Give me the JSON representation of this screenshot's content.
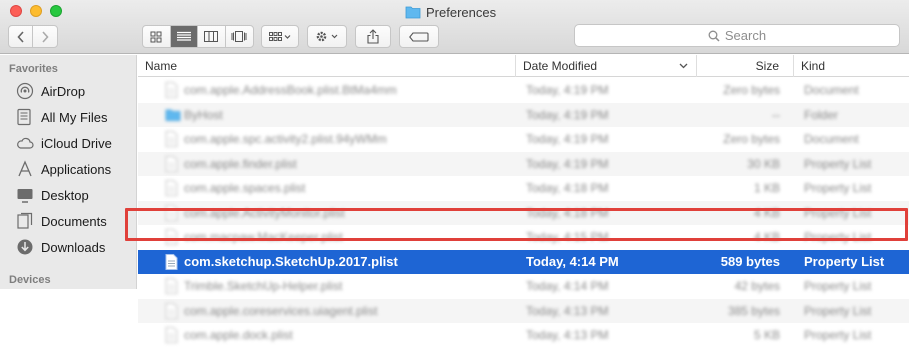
{
  "window": {
    "title": "Preferences"
  },
  "toolbar": {
    "search_placeholder": "Search"
  },
  "sidebar": {
    "favorites_heading": "Favorites",
    "devices_heading": "Devices",
    "items": [
      {
        "label": "AirDrop",
        "icon": "airdrop-icon"
      },
      {
        "label": "All My Files",
        "icon": "all-files-icon"
      },
      {
        "label": "iCloud Drive",
        "icon": "cloud-icon"
      },
      {
        "label": "Applications",
        "icon": "applications-icon"
      },
      {
        "label": "Desktop",
        "icon": "desktop-icon"
      },
      {
        "label": "Documents",
        "icon": "documents-icon"
      },
      {
        "label": "Downloads",
        "icon": "downloads-icon"
      }
    ]
  },
  "columns": {
    "name": "Name",
    "date": "Date Modified",
    "size": "Size",
    "kind": "Kind"
  },
  "rows": [
    {
      "name": "com.apple.AddressBook.plist.BtMa4mm",
      "date": "Today, 4:19 PM",
      "size": "Zero bytes",
      "kind": "Document",
      "blurred": true
    },
    {
      "name": "ByHost",
      "date": "Today, 4:19 PM",
      "size": "--",
      "kind": "Folder",
      "blurred": true,
      "folder": true
    },
    {
      "name": "com.apple.spc.activity2.plist.94yWMm",
      "date": "Today, 4:19 PM",
      "size": "Zero bytes",
      "kind": "Document",
      "blurred": true
    },
    {
      "name": "com.apple.finder.plist",
      "date": "Today, 4:19 PM",
      "size": "30 KB",
      "kind": "Property List",
      "blurred": true
    },
    {
      "name": "com.apple.spaces.plist",
      "date": "Today, 4:18 PM",
      "size": "1 KB",
      "kind": "Property List",
      "blurred": true
    },
    {
      "name": "com.apple.ActivityMonitor.plist",
      "date": "Today, 4:18 PM",
      "size": "4 KB",
      "kind": "Property List",
      "blurred": true
    },
    {
      "name": "com.macpaw.MacKeeper.plist",
      "date": "Today, 4:15 PM",
      "size": "4 KB",
      "kind": "Property List",
      "blurred": true
    },
    {
      "name": "com.sketchup.SketchUp.2017.plist",
      "date": "Today, 4:14 PM",
      "size": "589 bytes",
      "kind": "Property List",
      "blurred": false,
      "selected": true
    },
    {
      "name": "Trimble.SketchUp-Helper.plist",
      "date": "Today, 4:14 PM",
      "size": "42 bytes",
      "kind": "Property List",
      "blurred": true
    },
    {
      "name": "com.apple.coreservices.uiagent.plist",
      "date": "Today, 4:13 PM",
      "size": "385 bytes",
      "kind": "Property List",
      "blurred": true
    },
    {
      "name": "com.apple.dock.plist",
      "date": "Today, 4:13 PM",
      "size": "5 KB",
      "kind": "Property List",
      "blurred": true
    }
  ],
  "colors": {
    "selection": "#1e65d4",
    "highlight": "#e0403a",
    "folder": "#5fb8ef"
  }
}
